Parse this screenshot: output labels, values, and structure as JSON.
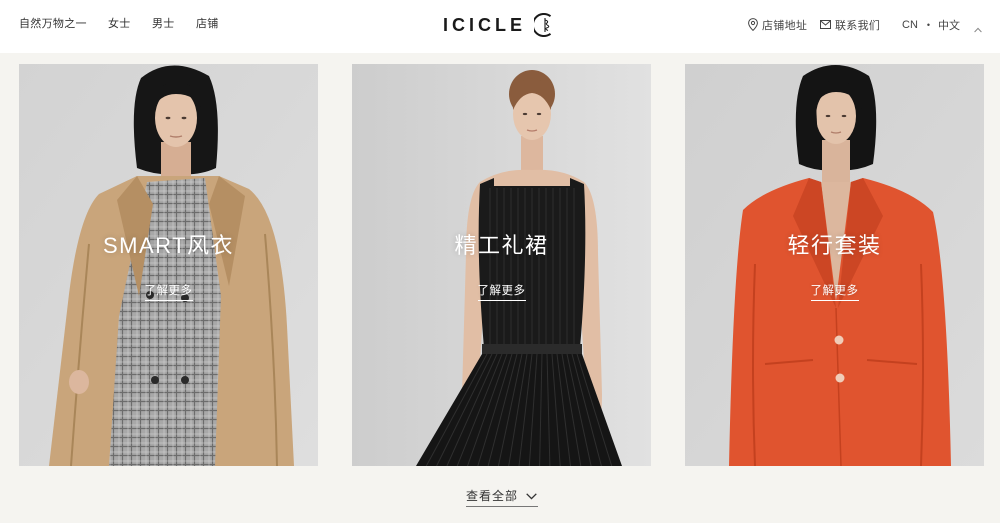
{
  "colors": {
    "page_bg": "#f5f4f0",
    "header_bg": "#ffffff",
    "text": "#333333",
    "card_text": "#ffffff"
  },
  "header": {
    "nav": [
      {
        "label": "自然万物之一"
      },
      {
        "label": "女士"
      },
      {
        "label": "男士"
      },
      {
        "label": "店铺"
      }
    ],
    "logo": {
      "text": "ICICLE",
      "emblem_icon": "logo-emblem-icon"
    },
    "store_address": {
      "label": "店铺地址",
      "icon": "location-pin-icon"
    },
    "contact": {
      "label": "联系我们",
      "icon": "mail-icon"
    },
    "language": {
      "code": "CN",
      "separator": "•",
      "name": "中文"
    },
    "scroll_top_icon": "chevron-up-icon"
  },
  "cards": [
    {
      "title": "SMART风衣",
      "link": "了解更多",
      "garment_color": "#c9a57b"
    },
    {
      "title": "精工礼裙",
      "link": "了解更多",
      "garment_color": "#1a1a1a"
    },
    {
      "title": "轻行套装",
      "link": "了解更多",
      "garment_color": "#e0542f"
    }
  ],
  "view_all": {
    "label": "查看全部",
    "icon": "chevron-down-icon"
  }
}
